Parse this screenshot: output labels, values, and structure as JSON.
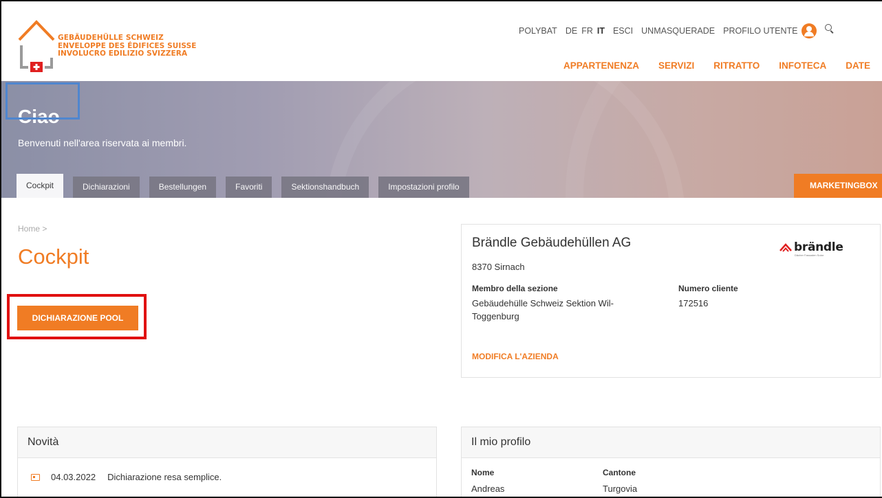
{
  "header": {
    "logo_lines": [
      "GEBÄUDEHÜLLE SCHWEIZ",
      "ENVELOPPE DES ÉDIFICES SUISSE",
      "INVOLUCRO EDILIZIO SVIZZERA"
    ],
    "top_links": {
      "polybat": "POLYBAT",
      "lang_de": "DE",
      "lang_fr": "FR",
      "lang_it": "IT",
      "logout": "ESCI",
      "unmasquerade": "UNMASQUERADE",
      "profile": "PROFILO UTENTE"
    },
    "main_nav": [
      "APPARTENENZA",
      "SERVIZI",
      "RITRATTO",
      "INFOTECA",
      "DATE"
    ]
  },
  "hero": {
    "title": "Ciao",
    "subtitle": "Benvenuti nell'area riservata ai membri.",
    "tabs": [
      "Cockpit",
      "Dichiarazioni",
      "Bestellungen",
      "Favoriti",
      "Sektionshandbuch",
      "Impostazioni profilo"
    ],
    "active_tab": "Cockpit",
    "marketing_tab": "MARKETINGBOX"
  },
  "content": {
    "breadcrumb": "Home >",
    "page_title": "Cockpit",
    "pool_button": "DICHIARAZIONE POOL"
  },
  "company": {
    "name": "Brändle Gebäudehüllen AG",
    "logo_text": "brändle",
    "logo_tagline": "Dächer Fassaden Solar",
    "city": "8370 Sirnach",
    "section_label": "Membro della sezione",
    "section_value_1": "Gebäudehülle Schweiz Sektion Wil-",
    "section_value_2": "Toggenburg",
    "customer_label": "Numero cliente",
    "customer_value": "172516",
    "edit_link": "MODIFICA L'AZIENDA"
  },
  "news": {
    "title": "Novità",
    "items": [
      {
        "date": "04.03.2022",
        "text": "Dichiarazione resa semplice."
      }
    ]
  },
  "profile": {
    "title": "Il mio profilo",
    "name_label": "Nome",
    "name_value": "Andreas",
    "canton_label": "Cantone",
    "canton_value": "Turgovia"
  },
  "colors": {
    "accent": "#f07c24",
    "highlight_blue": "#4f86cf",
    "highlight_red": "#e01010"
  }
}
